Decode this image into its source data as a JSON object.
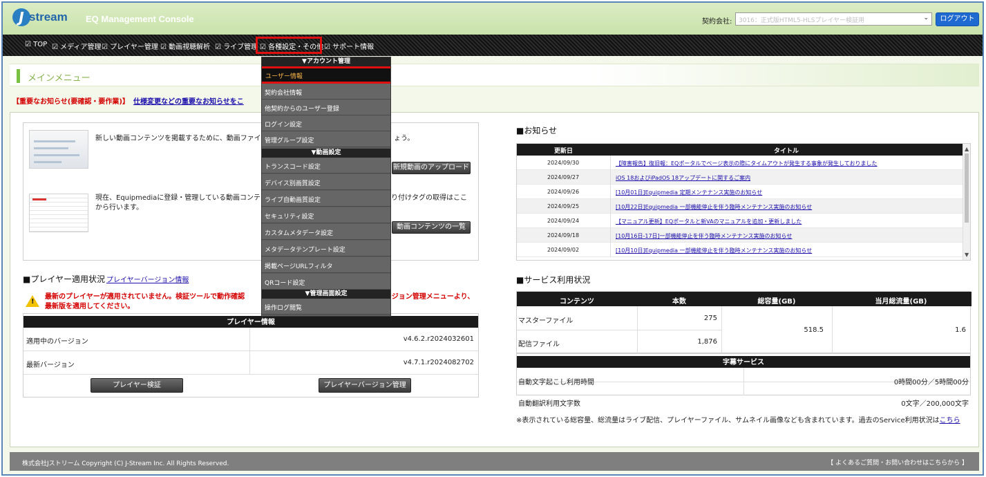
{
  "header": {
    "logo_text": "stream",
    "logo_letter": "J",
    "console_title": "EQ Management Console",
    "company_label": "契約会社:",
    "company_value": "3016：正式版HTML5-HLSプレイヤー検証用",
    "logout_label": "ログアウト"
  },
  "nav": {
    "items": [
      "TOP",
      "メディア管理",
      "プレイヤー管理",
      "動画視聴解析",
      "ライブ管理",
      "各種設定・その他",
      "サポート情報"
    ],
    "active_index": 5
  },
  "main_menu_title": "メインメニュー",
  "notice": {
    "label": "【重要なお知らせ(要確認・要作業)】",
    "link": "仕様変更などの重要なお知らせをこ"
  },
  "content": {
    "item1_text": "新しい動画コンテンツを掲載するために、動画ファイルを",
    "item1_text_tail": "ょう。",
    "item1_button": "新規動画のアップロード",
    "item2_text_a": "現在、Equipmediaに登録・管理している動画コンテンツ",
    "item2_text_tail": "り付けタグの取得はここ",
    "item2_text_b": "から行います。",
    "item2_button": "動画コンテンツの一覧"
  },
  "player": {
    "title": "■プレイヤー適用状況",
    "title_link": "プレイヤーバージョン情報",
    "warning_a": "最新のプレイヤーが適用されていません。検証ツールで動作確認",
    "warning_tail": "ージョン管理メニューより、",
    "warning_b": "最新版を適用してください。",
    "table_header": "プレイヤー情報",
    "rows": [
      {
        "label": "適用中のバージョン",
        "value": "v4.6.2.r2024032601"
      },
      {
        "label": "最新バージョン",
        "value": "v4.7.1.r2024082702"
      }
    ],
    "verify_button": "プレイヤー検証",
    "manage_button": "プレイヤーバージョン管理"
  },
  "news": {
    "title": "■お知らせ",
    "col_date": "更新日",
    "col_title": "タイトル",
    "rows": [
      {
        "date": "2024/09/30",
        "title": "【障害報告】復旧報：EQポータルでページ表示の際にタイムアウトが発生する事象が発生しておりました"
      },
      {
        "date": "2024/09/27",
        "title": "iOS 18およびiPadOS 18アップデートに関するご案内"
      },
      {
        "date": "2024/09/26",
        "title": "[10月01日]Equipmedia 定期メンテナンス実施のお知らせ"
      },
      {
        "date": "2024/09/25",
        "title": "[10月22日]Equipmedia 一部機能停止を伴う臨時メンテナンス実施のお知らせ"
      },
      {
        "date": "2024/09/24",
        "title": "【マニュアル更新】EQポータルと新VAのマニュアルを追加・更新しました"
      },
      {
        "date": "2024/09/18",
        "title": "[10月16日-17日]一部機能停止を伴う臨時メンテナンス実施のお知らせ"
      },
      {
        "date": "2024/09/02",
        "title": "[10月10日]Equipmedia 一部機能停止を伴う臨時メンテナンス実施のお知らせ"
      }
    ]
  },
  "service": {
    "title": "■サービス利用状況",
    "headers": [
      "コンテンツ",
      "本数",
      "総容量(GB)",
      "当月総流量(GB)"
    ],
    "rows": [
      {
        "label": "マスターファイル",
        "count": "275"
      },
      {
        "label": "配信ファイル",
        "count": "1,876"
      }
    ],
    "total_capacity": "518.5",
    "monthly_traffic": "1.6",
    "caption_header": "字幕サービス",
    "caption_rows": [
      {
        "label": "自動文字起こし利用時間",
        "value": "0時間00分／5時間00分"
      },
      {
        "label": "自動翻訳利用文字数",
        "value": "0文字／200,000文字"
      }
    ],
    "note": "※表示されている総容量、総流量はライブ配信、プレイヤーファイル、サムネイル画像なども含まれています。過去のService利用状況は",
    "note_link": "こちら"
  },
  "dropdown": {
    "groups": [
      {
        "label": "▼アカウント管理",
        "items": [
          "ユーザー情報",
          "契約会社情報",
          "他契約からのユーザー登録",
          "ログイン設定",
          "管理グループ設定"
        ]
      },
      {
        "label": "▼動画設定",
        "items": [
          "トランスコード設定",
          "デバイス別画質設定",
          "ライブ自動画質設定",
          "セキュリティ設定",
          "カスタムメタデータ設定",
          "メタデータテンプレート設定",
          "掲載ページURLフィルタ",
          "QRコード設定"
        ]
      },
      {
        "label": "▼管理画面設定",
        "items": [
          "操作ログ閲覧"
        ]
      }
    ],
    "selected_item": "ユーザー情報"
  },
  "footer": {
    "copyright": "株式会社Jストリーム Copyright (C) J-Stream Inc. All Rights Reserved.",
    "faq": "【 よくあるご質問・お問い合わせはこちらから 】"
  }
}
